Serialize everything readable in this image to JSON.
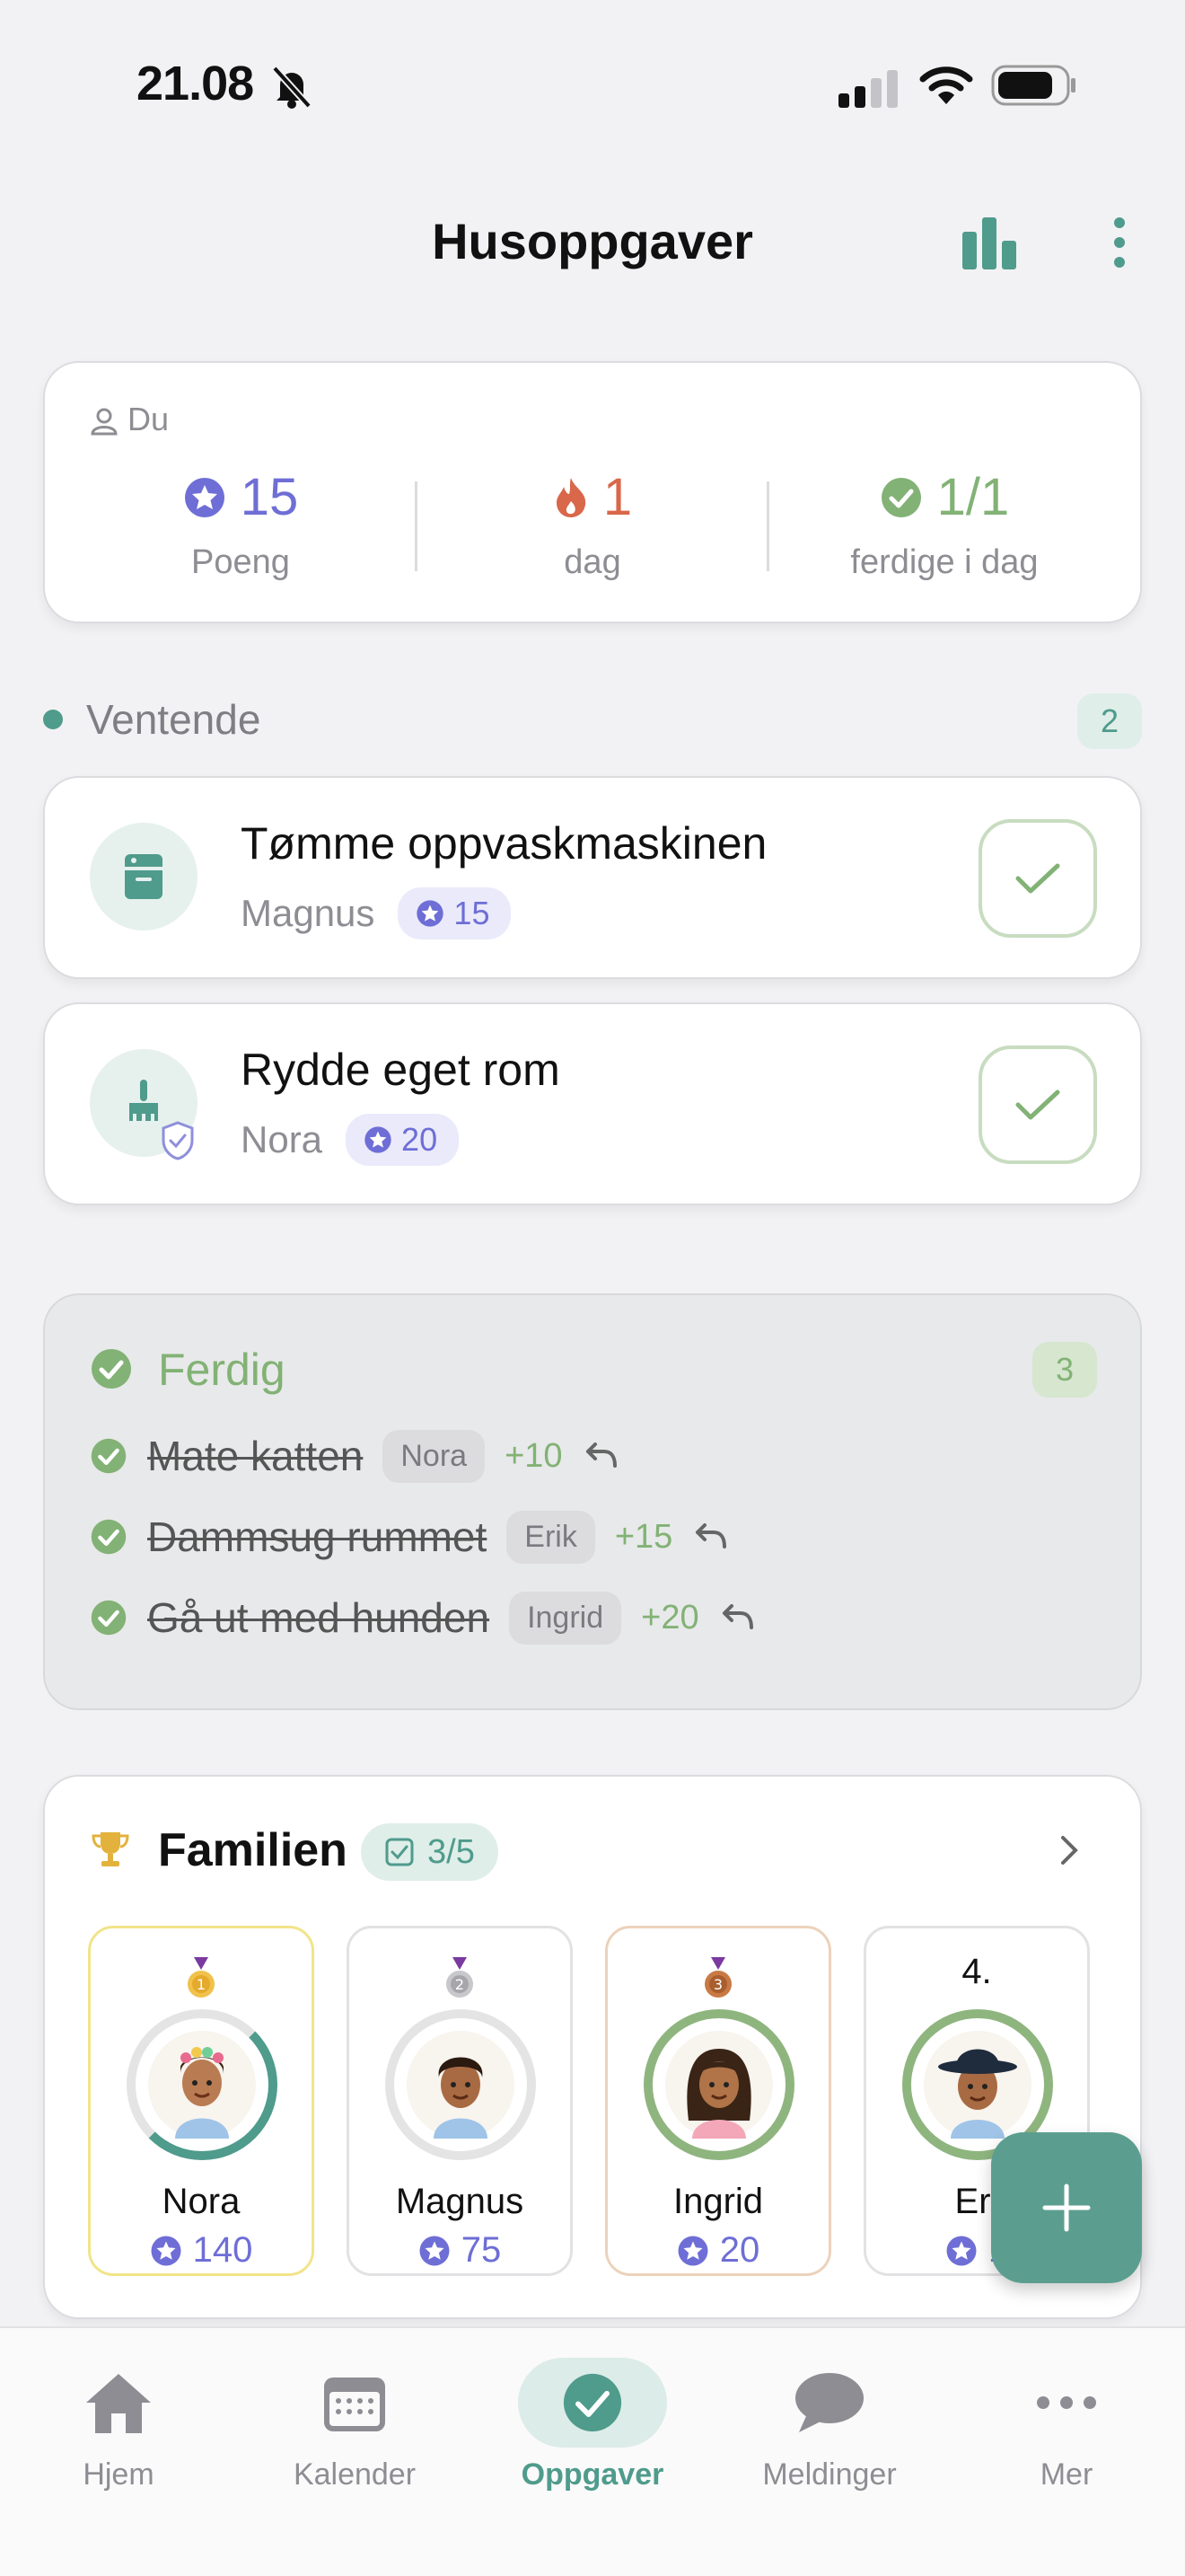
{
  "status_bar": {
    "time": "21.08"
  },
  "header": {
    "title": "Husoppgaver"
  },
  "stats": {
    "label": "Du",
    "points_value": "15",
    "points_label": "Poeng",
    "streak_value": "1",
    "streak_label": "dag",
    "done_value": "1/1",
    "done_label": "ferdige i dag"
  },
  "pending": {
    "title": "Ventende",
    "count": "2",
    "tasks": [
      {
        "name": "Tømme oppvaskmaskinen",
        "assignee": "Magnus",
        "points": "15"
      },
      {
        "name": "Rydde eget rom",
        "assignee": "Nora",
        "points": "20"
      }
    ]
  },
  "done": {
    "title": "Ferdig",
    "count": "3",
    "tasks": [
      {
        "name": "Mate katten",
        "who": "Nora",
        "points": "+10"
      },
      {
        "name": "Dammsug rummet",
        "who": "Erik",
        "points": "+15"
      },
      {
        "name": "Gå ut med hunden",
        "who": "Ingrid",
        "points": "+20"
      }
    ]
  },
  "family": {
    "title": "Familien",
    "badge": "3/5",
    "members": [
      {
        "rank": "1",
        "name": "Nora",
        "points": "140"
      },
      {
        "rank": "2",
        "name": "Magnus",
        "points": "75"
      },
      {
        "rank": "3",
        "name": "Ingrid",
        "points": "20"
      },
      {
        "rank": "4.",
        "name": "Eri",
        "points": "1"
      }
    ]
  },
  "tabs": [
    {
      "label": "Hjem"
    },
    {
      "label": "Kalender"
    },
    {
      "label": "Oppgaver"
    },
    {
      "label": "Meldinger"
    },
    {
      "label": "Mer"
    }
  ],
  "colors": {
    "accent": "#4f9b8c",
    "points": "#6e6ed6",
    "streak": "#d9674a",
    "done": "#82b275"
  }
}
